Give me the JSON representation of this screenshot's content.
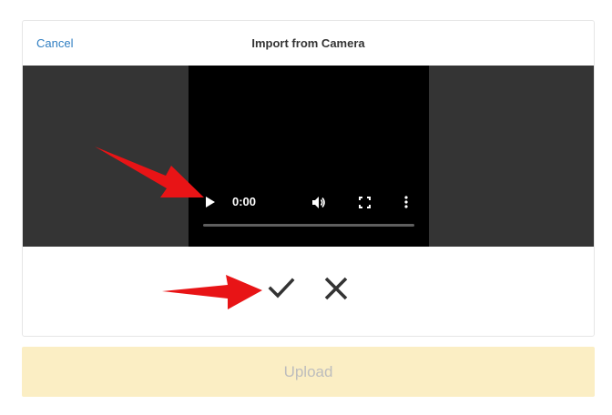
{
  "dialog": {
    "cancel_label": "Cancel",
    "title": "Import from Camera"
  },
  "video": {
    "time": "0:00",
    "progress_fraction": 0,
    "icons": [
      "play-icon",
      "volume-icon",
      "fullscreen-icon",
      "more-vert-icon"
    ]
  },
  "actions": {
    "confirm_icon": "checkmark-icon",
    "reject_icon": "close-icon"
  },
  "upload": {
    "label": "Upload"
  },
  "annotations": {
    "arrow_color": "#e81416"
  },
  "colors": {
    "link": "#2f7ec2",
    "video_bg": "#343434",
    "player_bg": "#000000",
    "upload_bg": "#fbeec4",
    "upload_text": "#bdbdbd"
  }
}
